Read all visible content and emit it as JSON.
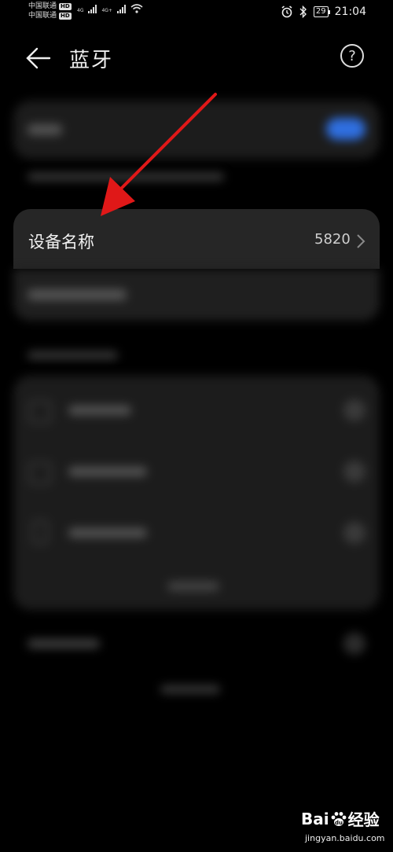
{
  "status": {
    "carrier1": "中国联通",
    "carrier2": "中国联通",
    "hd": "HD",
    "net1": "4G",
    "net2": "4G+",
    "battery": "29",
    "time": "21:04"
  },
  "header": {
    "title": "蓝牙"
  },
  "device_name": {
    "label": "设备名称",
    "value": "5820"
  },
  "watermark": {
    "brand_left": "Bai",
    "brand_right": "经验",
    "url": "jingyan.baidu.com"
  },
  "colors": {
    "background": "#000000",
    "card": "#262626",
    "toggle_accent": "#2f6fe0",
    "arrow": "#e01818"
  }
}
